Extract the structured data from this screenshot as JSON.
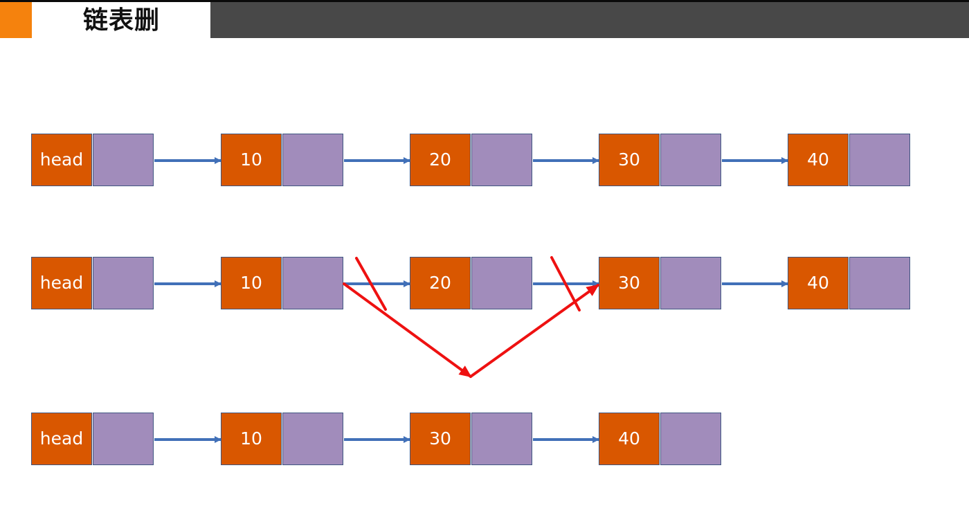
{
  "header": {
    "title": "链表删"
  },
  "colors": {
    "accent": "#f5820d",
    "header_bar": "#484848",
    "node_value": "#d95700",
    "node_pointer": "#a18cbb",
    "node_border": "#3f5681",
    "arrow": "#4170b8",
    "deletion_mark": "#ee1111"
  },
  "rows": [
    {
      "name": "original-list",
      "nodes": [
        "head",
        "10",
        "20",
        "30",
        "40"
      ]
    },
    {
      "name": "deleting-node-20",
      "nodes": [
        "head",
        "10",
        "20",
        "30",
        "40"
      ],
      "crossed_links": [
        "10->20",
        "20->30"
      ],
      "redirect": "10->30"
    },
    {
      "name": "result-list",
      "nodes": [
        "head",
        "10",
        "30",
        "40"
      ]
    }
  ]
}
